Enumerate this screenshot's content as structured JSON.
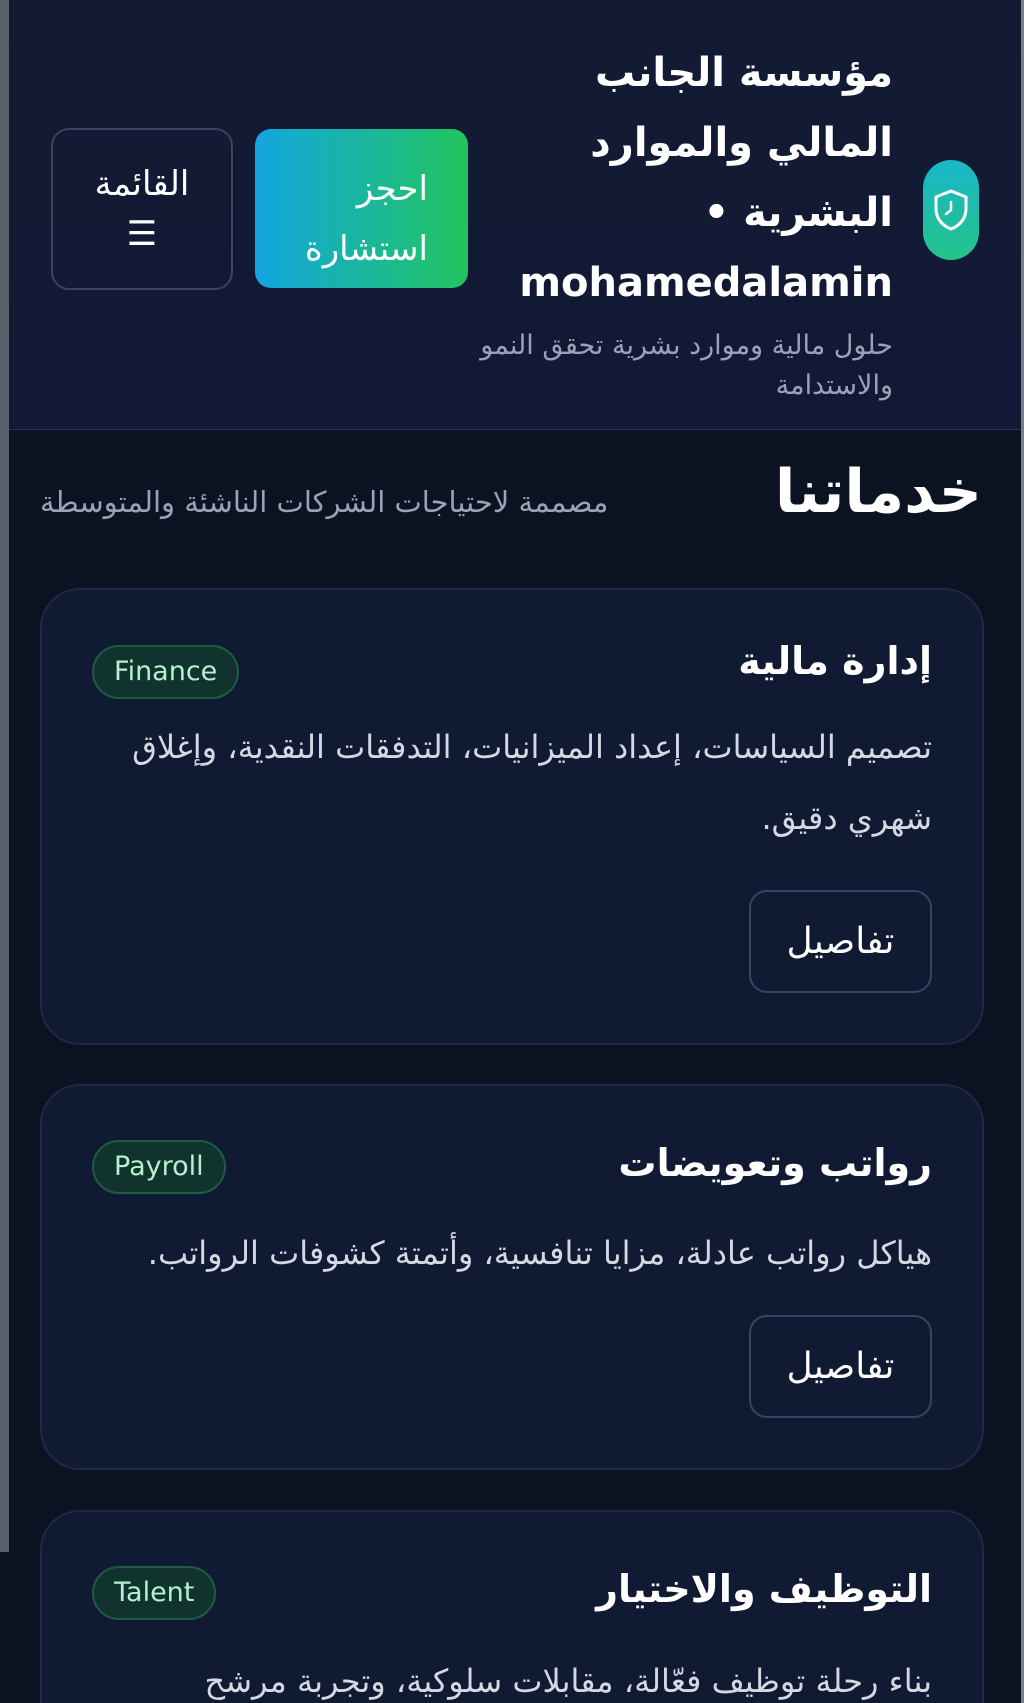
{
  "header": {
    "brand_title": "مؤسسة الجانب المالي والموارد البشرية • mohamedalamin",
    "tagline": "حلول مالية وموارد بشرية تحقق النمو والاستدامة",
    "book_button": "احجز استشارة",
    "menu_label": "القائمة",
    "menu_icon": "☰",
    "brand_icon": "shield-icon"
  },
  "services": {
    "title": "خدماتنا",
    "subtitle": "مصممة لاحتياجات الشركات الناشئة والمتوسطة",
    "cards": [
      {
        "title": "إدارة مالية",
        "tag": "Finance",
        "description": "تصميم السياسات، إعداد الميزانيات، التدفقات النقدية، وإغلاق شهري دقيق.",
        "button": "تفاصيل"
      },
      {
        "title": "رواتب وتعويضات",
        "tag": "Payroll",
        "description": "هياكل رواتب عادلة، مزايا تنافسية، وأتمتة كشوفات الرواتب.",
        "button": "تفاصيل"
      },
      {
        "title": "التوظيف والاختيار",
        "tag": "Talent",
        "description": "بناء رحلة توظيف فعّالة، مقابلات سلوكية، وتجربة مرشح"
      }
    ]
  },
  "colors": {
    "background": "#0b1222",
    "header_bg": "#121a33",
    "card_bg": "#111a33",
    "accent_gradient_start": "#13a6e0",
    "accent_gradient_end": "#22c55e",
    "tag_bg": "#11332d",
    "tag_text": "#b5f0cf",
    "muted_text": "#9aa3b5"
  }
}
